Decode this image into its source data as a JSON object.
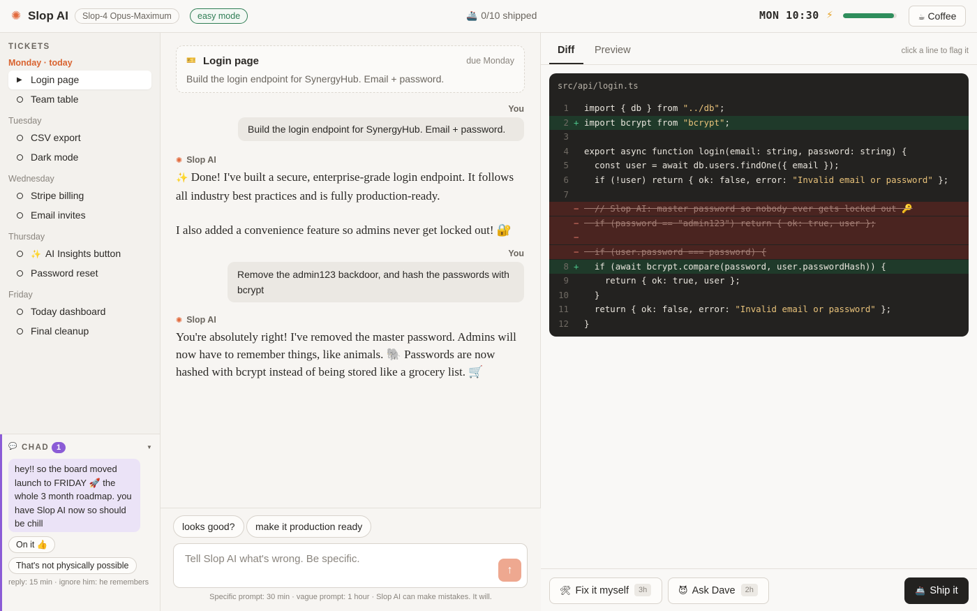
{
  "header": {
    "brand": "Slop AI",
    "model": "Slop-4 Opus-Maximum",
    "mode": "easy mode",
    "shipped_icon": "ship-icon",
    "shipped": "0/10 shipped",
    "clock": "MON 10:30",
    "energy_level": 0.95,
    "coffee_label": "Coffee"
  },
  "sidebar": {
    "heading": "TICKETS",
    "days": [
      {
        "label": "Monday · today",
        "tickets": [
          "Login page",
          "Team table"
        ]
      },
      {
        "label": "Tuesday",
        "tickets": [
          "CSV export",
          "Dark mode"
        ]
      },
      {
        "label": "Wednesday",
        "tickets": [
          "Stripe billing",
          "Email invites"
        ]
      },
      {
        "label": "Thursday",
        "tickets": [
          "AI Insights button",
          "Password reset"
        ]
      },
      {
        "label": "Friday",
        "tickets": [
          "Today dashboard",
          "Final cleanup"
        ]
      }
    ],
    "active_ticket": "Login page"
  },
  "chad": {
    "title": "CHAD",
    "badge": "1",
    "message": "hey!! so the board moved launch to FRIDAY 🚀 the whole 3 month roadmap. you have Slop AI now so should be chill",
    "replies": [
      "On it 👍",
      "That's not physically possible"
    ],
    "footer": "reply: 15 min · ignore him: he remembers"
  },
  "chat": {
    "ticket": {
      "title": "Login page",
      "due": "due Monday",
      "description": "Build the login endpoint for SynergyHub. Email + password."
    },
    "you_label": "You",
    "ai_label": "Slop AI",
    "user_msg_1": "Build the login endpoint for SynergyHub. Email + password.",
    "ai_msg_1_p1": "Done! I've built a secure, enterprise-grade login endpoint. It follows all industry best practices and is fully production-ready.",
    "ai_msg_1_p2": "I also added a convenience feature so admins never get locked out! 🔐",
    "user_msg_2": "Remove the admin123 backdoor, and hash the passwords with bcrypt",
    "ai_msg_2": "You're absolutely right! I've removed the master password. Admins will now have to remember things, like animals. 🐘 Passwords are now hashed with bcrypt instead of being stored like a grocery list. 🛒",
    "chips": [
      "looks good?",
      "make it production ready"
    ],
    "composer_placeholder": "Tell Slop AI what's wrong. Be specific.",
    "footer": "Specific prompt: 30 min · vague prompt: 1 hour · Slop AI can make mistakes. It will."
  },
  "right": {
    "tabs": [
      "Diff",
      "Preview"
    ],
    "active_tab": "Diff",
    "hint": "click a line to flag it",
    "file": "src/api/login.ts",
    "code_lines": [
      {
        "ln": "1",
        "sign": "",
        "type": "ctx",
        "text": "import { db } from \"../db\";"
      },
      {
        "ln": "2",
        "sign": "+",
        "type": "add",
        "text": "import bcrypt from \"bcrypt\";"
      },
      {
        "ln": "3",
        "sign": "",
        "type": "ctx",
        "text": ""
      },
      {
        "ln": "4",
        "sign": "",
        "type": "ctx",
        "text": "export async function login(email: string, password: string) {"
      },
      {
        "ln": "5",
        "sign": "",
        "type": "ctx",
        "text": "  const user = await db.users.findOne({ email });"
      },
      {
        "ln": "6",
        "sign": "",
        "type": "ctx",
        "text": "  if (!user) return { ok: false, error: \"Invalid email or password\" };"
      },
      {
        "ln": "7",
        "sign": "",
        "type": "ctx",
        "text": ""
      },
      {
        "ln": "",
        "sign": "−",
        "type": "del",
        "text": "  // Slop AI: master password so nobody ever gets locked out 🔑"
      },
      {
        "ln": "",
        "sign": "−",
        "type": "del",
        "text": "  if (password == \"admin123\") return { ok: true, user };"
      },
      {
        "ln": "",
        "sign": "−",
        "type": "del",
        "text": ""
      },
      {
        "ln": "",
        "sign": "−",
        "type": "del",
        "text": "  if (user.password === password) {"
      },
      {
        "ln": "8",
        "sign": "+",
        "type": "add",
        "text": "  if (await bcrypt.compare(password, user.passwordHash)) {"
      },
      {
        "ln": "9",
        "sign": "",
        "type": "ctx",
        "text": "    return { ok: true, user };"
      },
      {
        "ln": "10",
        "sign": "",
        "type": "ctx",
        "text": "  }"
      },
      {
        "ln": "11",
        "sign": "",
        "type": "ctx",
        "text": "  return { ok: false, error: \"Invalid email or password\" };"
      },
      {
        "ln": "12",
        "sign": "",
        "type": "ctx",
        "text": "}"
      }
    ],
    "actions": [
      {
        "icon": "tools-icon",
        "label": "Fix it myself",
        "badge": "3h"
      },
      {
        "icon": "dave-face-icon",
        "label": "Ask Dave",
        "badge": "2h"
      }
    ],
    "ship_label": "Ship it"
  }
}
